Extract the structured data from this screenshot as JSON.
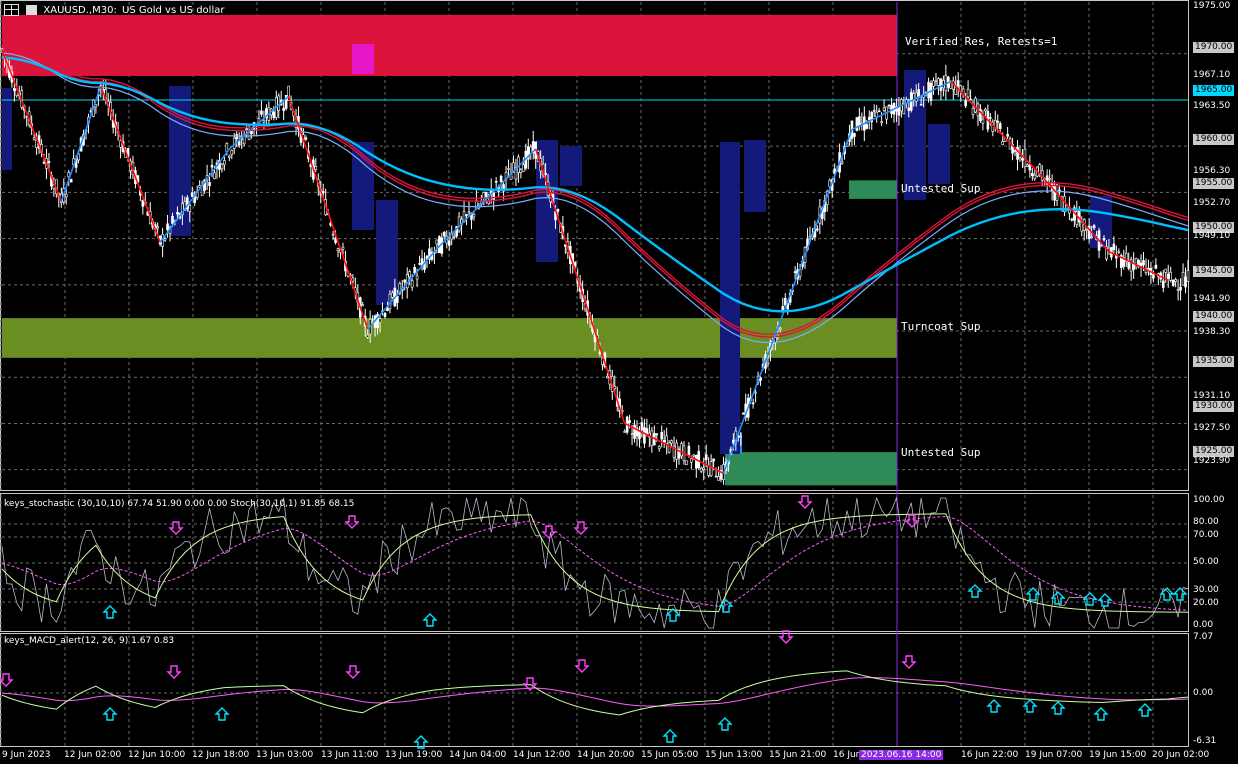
{
  "header": {
    "symbol": "XAUUSD.,M30:",
    "description": "US Gold vs US dollar"
  },
  "indicators": {
    "stoch_label": "keys_stochastic (30,10,10) 67.74 51.90 0.00 0.00 Stoch(30,10,1) 91.85 68.15",
    "macd_label": "keys_MACD_alert(12, 26, 9) 1.67 0.83"
  },
  "zones": [
    {
      "label": "Verified Res, Retests=1",
      "color": "#dc143c",
      "low": 1967.6,
      "high": 1974.2
    },
    {
      "label": "Untested Sup",
      "color": "#2e8b57",
      "low": 1954.3,
      "high": 1956.3
    },
    {
      "label": "Turncoat Sup",
      "color": "#6b8e23",
      "low": 1937.1,
      "high": 1941.4
    },
    {
      "label": "Untested Sup",
      "color": "#2e8b57",
      "low": 1923.3,
      "high": 1926.9
    }
  ],
  "price_axis": {
    "labels": [
      "1975.00",
      "1970.00",
      "1967.10",
      "1963.50",
      "1960.00",
      "1956.30",
      "1955.00",
      "1952.70",
      "1950.00",
      "1949.10",
      "1945.00",
      "1941.90",
      "1940.00",
      "1938.30",
      "1935.00",
      "1931.10",
      "1930.00",
      "1927.50",
      "1925.00",
      "1923.90"
    ],
    "current_price": "1965.00",
    "max": 1975.6,
    "min": 1922.8
  },
  "stoch_axis": {
    "labels": [
      "100.00",
      "80.00",
      "70.00",
      "50.00",
      "30.00",
      "20.00",
      "0.00"
    ]
  },
  "macd_axis": {
    "labels": [
      "7.07",
      "0.00",
      "-6.31"
    ],
    "max": 7.07,
    "min": -6.31
  },
  "time_axis": {
    "labels": [
      "9 Jun 2023",
      "12 Jun 02:00",
      "12 Jun 10:00",
      "12 Jun 18:00",
      "13 Jun 03:00",
      "13 Jun 11:00",
      "13 Jun 19:00",
      "14 Jun 04:00",
      "14 Jun 12:00",
      "14 Jun 20:00",
      "15 Jun 05:00",
      "15 Jun 13:00",
      "15 Jun 21:00",
      "16 Jun",
      "2023.06.16 14:00",
      "16 Jun 22:00",
      "19 Jun 07:00",
      "19 Jun 15:00",
      "20 Jun 02:00"
    ]
  },
  "colors": {
    "bull_swing": "#1e90ff",
    "bear_swing": "#ff1010",
    "ma_fast": "#00bfff",
    "ma_slow": "#dc143c",
    "stoch_main": "#d0ffa0",
    "stoch_signal": "#ff5cff",
    "arrow_up": "#00e5ff",
    "arrow_down": "#ff40ff",
    "crosshair": "#8a2be2"
  },
  "chart_data": {
    "type": "line",
    "swing_points": [
      {
        "t": 0,
        "p": 1970.4
      },
      {
        "t": 6,
        "p": 1954.0
      },
      {
        "t": 10,
        "p": 1966.5
      },
      {
        "t": 16,
        "p": 1949.6
      },
      {
        "t": 23,
        "p": 1959.7
      },
      {
        "t": 29,
        "p": 1965.4
      },
      {
        "t": 37,
        "p": 1940.2
      },
      {
        "t": 44,
        "p": 1948.9
      },
      {
        "t": 54,
        "p": 1959.7
      },
      {
        "t": 63,
        "p": 1930.0
      },
      {
        "t": 73,
        "p": 1924.6
      },
      {
        "t": 86,
        "p": 1961.8
      },
      {
        "t": 96,
        "p": 1967.0
      },
      {
        "t": 105,
        "p": 1957.0
      },
      {
        "t": 112,
        "p": 1948.6
      },
      {
        "t": 118,
        "p": 1945.5
      }
    ]
  }
}
